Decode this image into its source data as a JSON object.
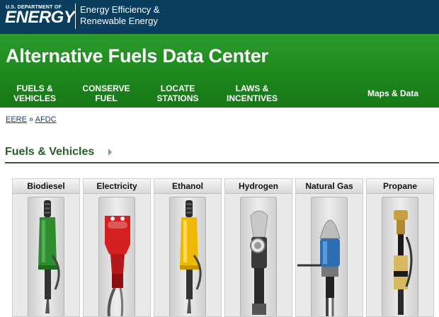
{
  "doe": {
    "small_label": "U.S. DEPARTMENT OF",
    "big_label": "ENERGY",
    "eere_line1": "Energy Efficiency &",
    "eere_line2": "Renewable Energy"
  },
  "site": {
    "title": "Alternative Fuels Data Center"
  },
  "nav": {
    "items": [
      {
        "line1": "FUELS &",
        "line2": "VEHICLES"
      },
      {
        "line1": "CONSERVE",
        "line2": "FUEL"
      },
      {
        "line1": "LOCATE",
        "line2": "STATIONS"
      },
      {
        "line1": "LAWS &",
        "line2": "INCENTIVES"
      }
    ],
    "right_link": "Maps & Data"
  },
  "breadcrumb": {
    "items": [
      "EERE",
      "AFDC"
    ],
    "separator": "»"
  },
  "section": {
    "title": "Fuels & Vehicles"
  },
  "fuels": [
    {
      "label": "Biodiesel",
      "color": "#2e8b2e",
      "icon": "green-fuel-nozzle"
    },
    {
      "label": "Electricity",
      "color": "#d42020",
      "icon": "red-charging-plug"
    },
    {
      "label": "Ethanol",
      "color": "#f0b800",
      "icon": "yellow-fuel-nozzle"
    },
    {
      "label": "Hydrogen",
      "color": "#444444",
      "icon": "hydrogen-nozzle"
    },
    {
      "label": "Natural Gas",
      "color": "#2e6fb3",
      "icon": "natural-gas-nozzle"
    },
    {
      "label": "Propane",
      "color": "#c8a040",
      "icon": "propane-nozzle"
    }
  ],
  "colors": {
    "doe_bar": "#0b3d5e",
    "header_green": "#1f8a1f",
    "section_green": "#2c5d2c"
  }
}
